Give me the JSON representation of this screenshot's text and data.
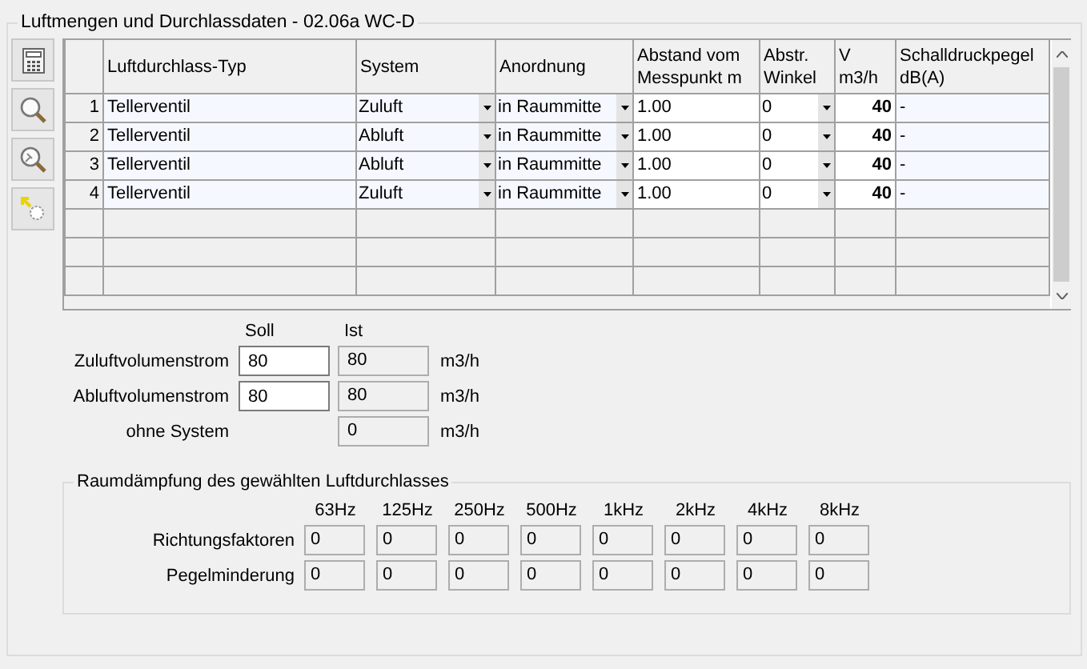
{
  "title": "Luftmengen und Durchlassdaten - 02.06a WC-D",
  "table": {
    "columns": [
      "Luftdurchlass-Typ",
      "System",
      "Anordnung",
      "Abstand vom\nMesspunkt m",
      "Abstr.\nWinkel",
      "V\nm3/h",
      "Schalldruckpegel\ndB(A)"
    ],
    "rows": [
      {
        "number": "1",
        "type": "Tellerventil",
        "system": "Zuluft",
        "arrangement": "in Raummitte",
        "distance": "1.00",
        "angle": "0",
        "flow": "40",
        "level": "-"
      },
      {
        "number": "2",
        "type": "Tellerventil",
        "system": "Abluft",
        "arrangement": "in Raummitte",
        "distance": "1.00",
        "angle": "0",
        "flow": "40",
        "level": "-"
      },
      {
        "number": "3",
        "type": "Tellerventil",
        "system": "Abluft",
        "arrangement": "in Raummitte",
        "distance": "1.00",
        "angle": "0",
        "flow": "40",
        "level": "-"
      },
      {
        "number": "4",
        "type": "Tellerventil",
        "system": "Zuluft",
        "arrangement": "in Raummitte",
        "distance": "1.00",
        "angle": "0",
        "flow": "40",
        "level": "-"
      }
    ]
  },
  "volumes": {
    "soll_label": "Soll",
    "ist_label": "Ist",
    "rows": [
      {
        "label": "Zuluftvolumenstrom",
        "soll": "80",
        "ist": "80",
        "unit": "m3/h"
      },
      {
        "label": "Abluftvolumenstrom",
        "soll": "80",
        "ist": "80",
        "unit": "m3/h"
      },
      {
        "label": "ohne System",
        "ist": "0",
        "unit": "m3/h"
      }
    ]
  },
  "damping": {
    "title": "Raumdämpfung des gewählten Luftdurchlasses",
    "frequencies": [
      "63Hz",
      "125Hz",
      "250Hz",
      "500Hz",
      "1kHz",
      "2kHz",
      "4kHz",
      "8kHz"
    ],
    "rows": [
      {
        "label": "Richtungsfaktoren",
        "values": [
          "0",
          "0",
          "0",
          "0",
          "0",
          "0",
          "0",
          "0"
        ]
      },
      {
        "label": "Pegelminderung",
        "values": [
          "0",
          "0",
          "0",
          "0",
          "0",
          "0",
          "0",
          "0"
        ]
      }
    ]
  }
}
